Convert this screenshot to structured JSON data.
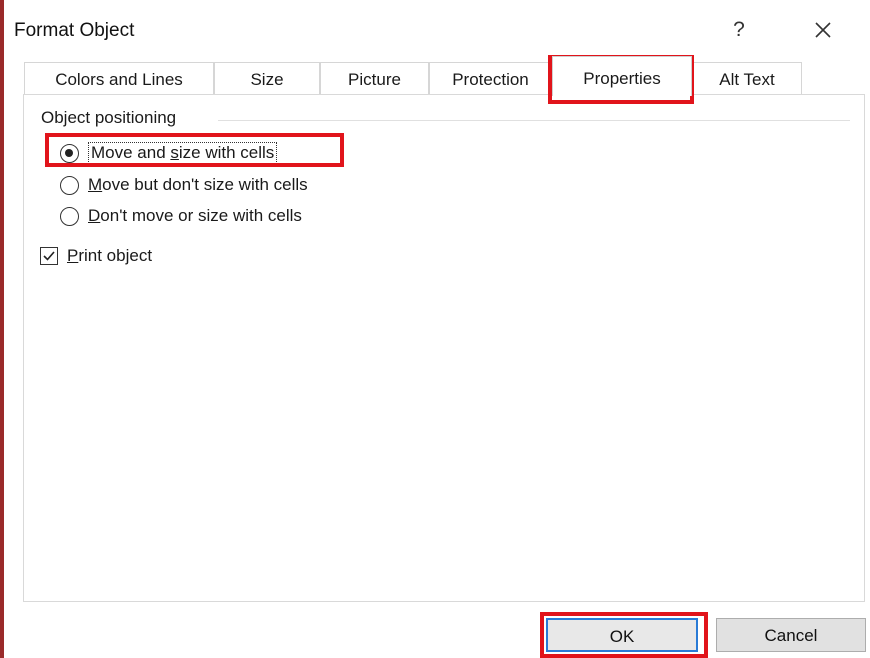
{
  "window": {
    "title": "Format Object",
    "help_label": "?"
  },
  "tabs": [
    {
      "label": "Colors and Lines"
    },
    {
      "label": "Size"
    },
    {
      "label": "Picture"
    },
    {
      "label": "Protection"
    },
    {
      "label": "Properties",
      "active": true
    },
    {
      "label": "Alt Text"
    }
  ],
  "object_positioning": {
    "group_label": "Object positioning",
    "options": [
      {
        "prefix": "Move and ",
        "mnemonic": "s",
        "suffix": "ize with cells",
        "selected": true
      },
      {
        "prefix": "",
        "mnemonic": "M",
        "suffix": "ove but don't size with cells",
        "selected": false
      },
      {
        "prefix": "",
        "mnemonic": "D",
        "suffix": "on't move or size with cells",
        "selected": false
      }
    ]
  },
  "print_object": {
    "mnemonic": "P",
    "suffix": "rint object",
    "checked": true
  },
  "buttons": {
    "ok_label": "OK",
    "cancel_label": "Cancel"
  },
  "colors": {
    "highlight": "#e1141b",
    "focus_border": "#2a7bd6"
  },
  "icons": {
    "help": "question-mark",
    "close": "close-x",
    "check": "check-mark"
  }
}
